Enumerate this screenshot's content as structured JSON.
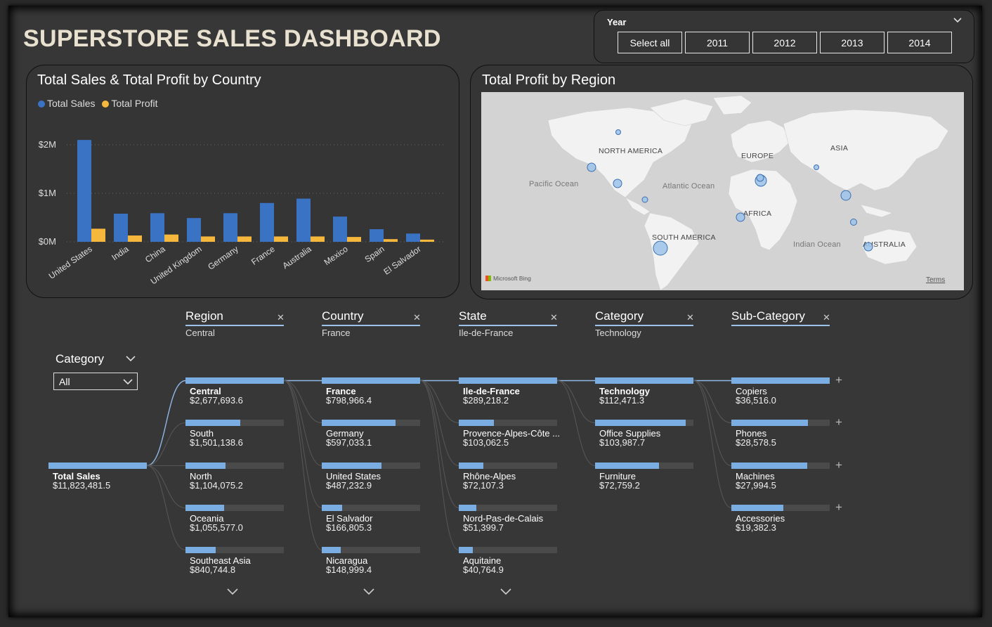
{
  "title": "SUPERSTORE SALES DASHBOARD",
  "year_slicer": {
    "label": "Year",
    "options": [
      "Select all",
      "2011",
      "2012",
      "2013",
      "2014"
    ]
  },
  "bar_chart_card": {
    "title": "Total Sales & Total Profit by Country"
  },
  "map_card": {
    "title": "Total Profit by Region",
    "labels": {
      "north_america": "NORTH AMERICA",
      "europe": "EUROPE",
      "asia": "ASIA",
      "africa": "AFRICA",
      "south_america": "SOUTH AMERICA",
      "australia": "AUSTRALIA",
      "pacific": "Pacific Ocean",
      "atlantic": "Atlantic Ocean",
      "indian": "Indian Ocean"
    },
    "attribution": "Microsoft Bing",
    "terms": "Terms"
  },
  "chart_data": {
    "type": "bar",
    "categories": [
      "United States",
      "India",
      "China",
      "United Kingdom",
      "Germany",
      "France",
      "Australia",
      "Mexico",
      "Spain",
      "El Salvador"
    ],
    "series": [
      {
        "name": "Total Sales",
        "color": "#3a73c4",
        "values": [
          2100000,
          580000,
          590000,
          490000,
          590000,
          800000,
          890000,
          520000,
          260000,
          170000
        ]
      },
      {
        "name": "Total Profit",
        "color": "#f5b83d",
        "values": [
          270000,
          130000,
          150000,
          110000,
          110000,
          110000,
          110000,
          100000,
          55000,
          45000
        ]
      }
    ],
    "yticks": [
      "$2M",
      "$1M",
      "$0M"
    ],
    "ylim": [
      0,
      2000000
    ],
    "xlabel": "",
    "ylabel": ""
  },
  "decomposition": {
    "category_filter": {
      "label": "Category",
      "value": "All"
    },
    "root": {
      "name": "Total Sales",
      "value": "$11,823,481.5"
    },
    "levels": [
      {
        "header": "Region",
        "selected": "Central",
        "nodes": [
          {
            "name": "Central",
            "value": "$2,677,693.6",
            "frac": 1.0,
            "bold": true
          },
          {
            "name": "South",
            "value": "$1,501,138.6",
            "frac": 0.56
          },
          {
            "name": "North",
            "value": "$1,104,075.2",
            "frac": 0.41
          },
          {
            "name": "Oceania",
            "value": "$1,055,577.0",
            "frac": 0.39
          },
          {
            "name": "Southeast Asia",
            "value": "$840,744.8",
            "frac": 0.31
          }
        ]
      },
      {
        "header": "Country",
        "selected": "France",
        "nodes": [
          {
            "name": "France",
            "value": "$798,966.4",
            "frac": 1.0,
            "bold": true
          },
          {
            "name": "Germany",
            "value": "$597,033.1",
            "frac": 0.75
          },
          {
            "name": "United States",
            "value": "$487,232.9",
            "frac": 0.61
          },
          {
            "name": "El Salvador",
            "value": "$166,805.3",
            "frac": 0.21
          },
          {
            "name": "Nicaragua",
            "value": "$148,999.4",
            "frac": 0.19
          }
        ]
      },
      {
        "header": "State",
        "selected": "Ile-de-France",
        "nodes": [
          {
            "name": "Ile-de-France",
            "value": "$289,218.2",
            "frac": 1.0,
            "bold": true
          },
          {
            "name": "Provence-Alpes-Côte ...",
            "value": "$103,062.5",
            "frac": 0.36
          },
          {
            "name": "Rhône-Alpes",
            "value": "$72,107.3",
            "frac": 0.25
          },
          {
            "name": "Nord-Pas-de-Calais",
            "value": "$51,399.7",
            "frac": 0.18
          },
          {
            "name": "Aquitaine",
            "value": "$40,764.9",
            "frac": 0.14
          }
        ]
      },
      {
        "header": "Category",
        "selected": "Technology",
        "nodes": [
          {
            "name": "Technology",
            "value": "$112,471.3",
            "frac": 1.0,
            "bold": true
          },
          {
            "name": "Office Supplies",
            "value": "$103,987.7",
            "frac": 0.92
          },
          {
            "name": "Furniture",
            "value": "$72,759.2",
            "frac": 0.65
          }
        ]
      },
      {
        "header": "Sub-Category",
        "selected": "",
        "nodes": [
          {
            "name": "Copiers",
            "value": "$36,516.0",
            "frac": 1.0
          },
          {
            "name": "Phones",
            "value": "$28,578.5",
            "frac": 0.78
          },
          {
            "name": "Machines",
            "value": "$27,994.5",
            "frac": 0.77
          },
          {
            "name": "Accessories",
            "value": "$19,382.3",
            "frac": 0.53
          }
        ]
      }
    ]
  }
}
